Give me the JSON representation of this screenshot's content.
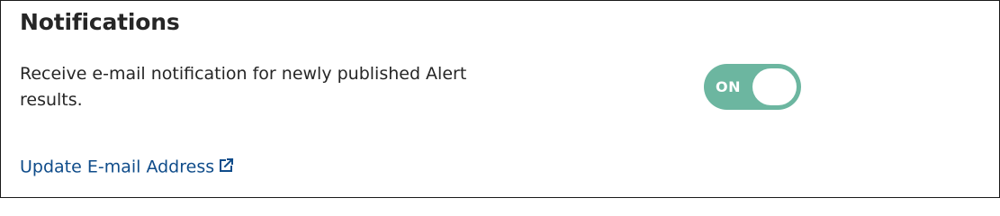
{
  "notifications": {
    "title": "Notifications",
    "description": "Receive e-mail notification for newly published Alert results.",
    "toggle": {
      "state_label": "ON",
      "is_on": true,
      "on_color": "#6cb6a0"
    },
    "update_email_link": {
      "label": "Update E-mail Address",
      "icon": "external-link-icon",
      "color": "#0f4c8a"
    }
  }
}
